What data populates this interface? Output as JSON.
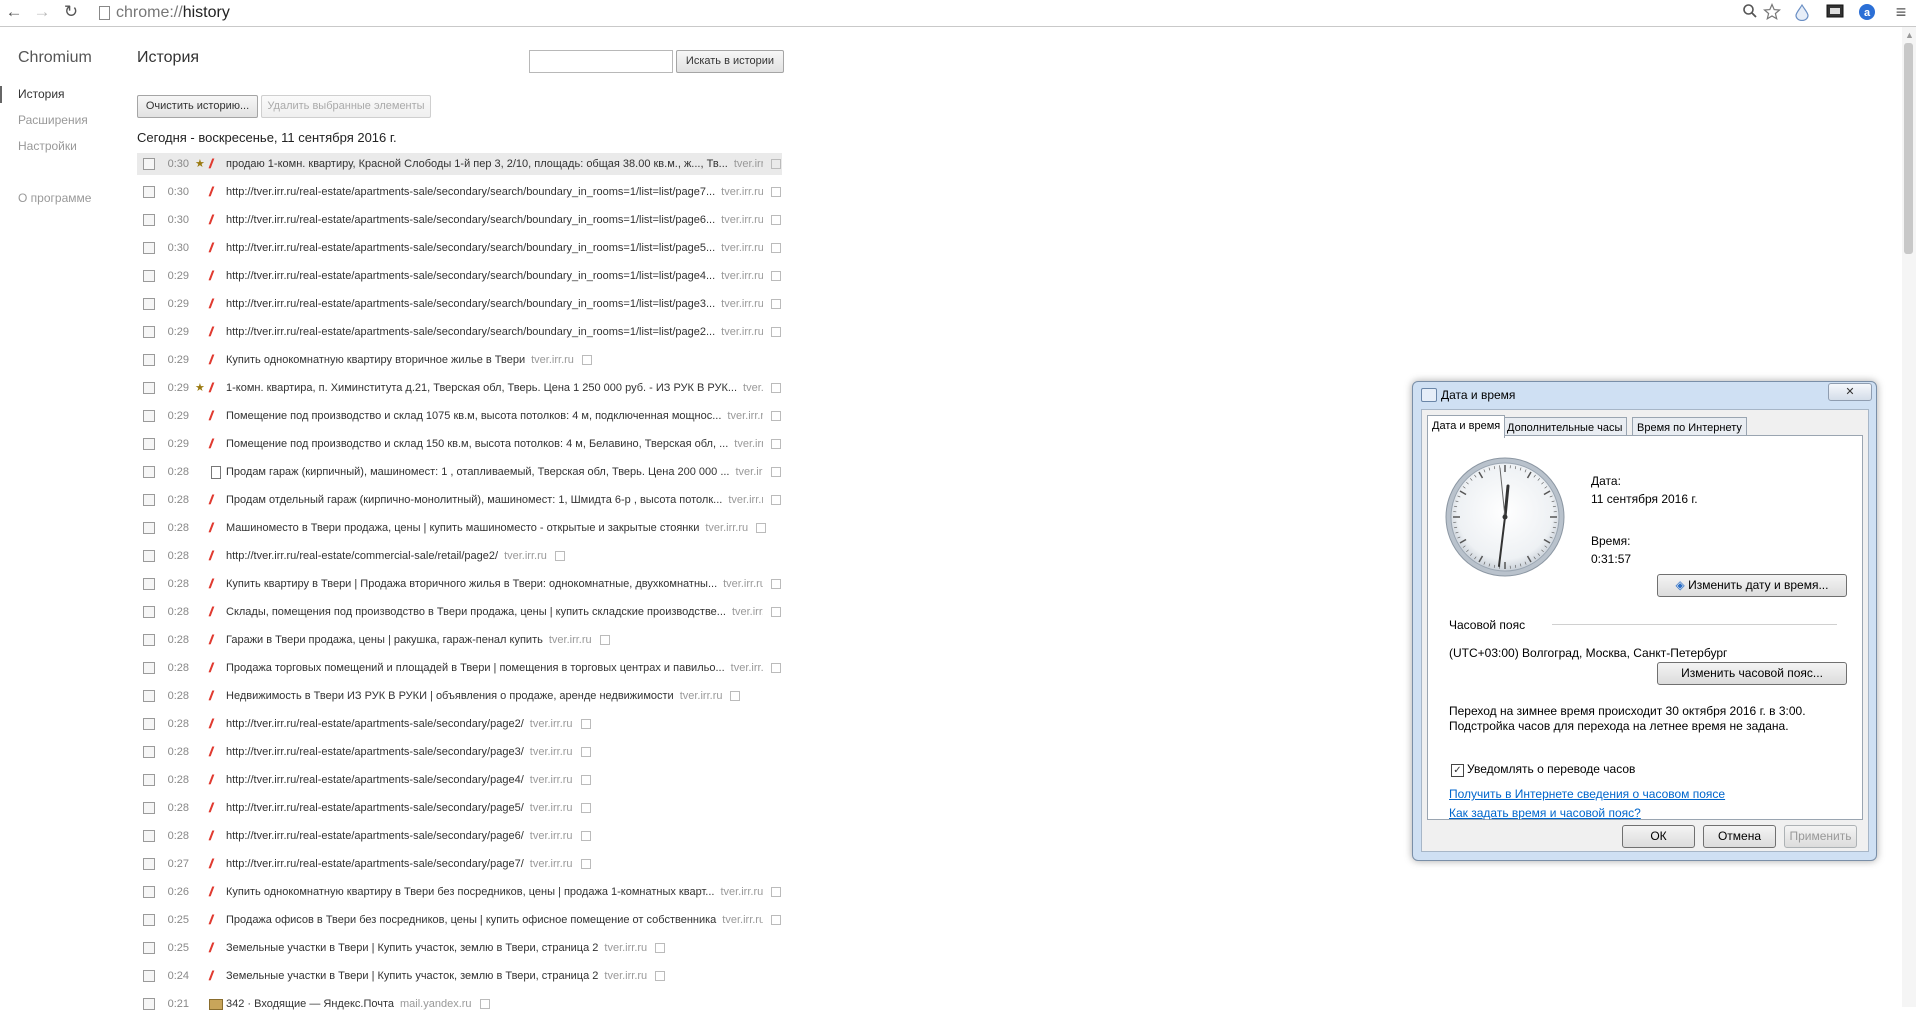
{
  "browser": {
    "url_scheme": "chrome://",
    "url_path": "history",
    "back_glyph": "←",
    "forward_glyph": "→",
    "reload_glyph": "↻",
    "menu_glyph": "≡"
  },
  "sidebar": {
    "brand": "Chromium",
    "items": [
      {
        "label": "История"
      },
      {
        "label": "Расширения"
      },
      {
        "label": "Настройки"
      },
      {
        "label": "О программе"
      }
    ]
  },
  "main": {
    "title": "История",
    "search_button": "Искать в истории",
    "clear_button": "Очистить историю...",
    "remove_button": "Удалить выбранные элементы",
    "day_header": "Сегодня - воскресенье, 11 сентября 2016 г."
  },
  "entries": [
    {
      "time": "0:30",
      "title": "продаю 1-комн. квартиру, Красной Слободы 1-й пер 3, 2/10, площадь: общая 38.00 кв.м., ж..., Тв...",
      "domain": "tver.irr.ru",
      "icon": "irr-icon",
      "starred": true
    },
    {
      "time": "0:30",
      "title": "http://tver.irr.ru/real-estate/apartments-sale/secondary/search/boundary_in_rooms=1/list=list/page7...",
      "domain": "tver.irr.ru",
      "icon": "irr-icon",
      "starred": false
    },
    {
      "time": "0:30",
      "title": "http://tver.irr.ru/real-estate/apartments-sale/secondary/search/boundary_in_rooms=1/list=list/page6...",
      "domain": "tver.irr.ru",
      "icon": "irr-icon",
      "starred": false
    },
    {
      "time": "0:30",
      "title": "http://tver.irr.ru/real-estate/apartments-sale/secondary/search/boundary_in_rooms=1/list=list/page5...",
      "domain": "tver.irr.ru",
      "icon": "irr-icon",
      "starred": false
    },
    {
      "time": "0:29",
      "title": "http://tver.irr.ru/real-estate/apartments-sale/secondary/search/boundary_in_rooms=1/list=list/page4...",
      "domain": "tver.irr.ru",
      "icon": "irr-icon",
      "starred": false
    },
    {
      "time": "0:29",
      "title": "http://tver.irr.ru/real-estate/apartments-sale/secondary/search/boundary_in_rooms=1/list=list/page3...",
      "domain": "tver.irr.ru",
      "icon": "irr-icon",
      "starred": false
    },
    {
      "time": "0:29",
      "title": "http://tver.irr.ru/real-estate/apartments-sale/secondary/search/boundary_in_rooms=1/list=list/page2...",
      "domain": "tver.irr.ru",
      "icon": "irr-icon",
      "starred": false
    },
    {
      "time": "0:29",
      "title": "Купить однокомнатную квартиру вторичное жилье в Твери",
      "domain": "tver.irr.ru",
      "icon": "irr-icon",
      "starred": false
    },
    {
      "time": "0:29",
      "title": "1-комн. квартира, п. Химинститута д.21, Тверская обл, Тверь. Цена 1 250 000 руб. - ИЗ РУК В РУК...",
      "domain": "tver.irr.ru",
      "icon": "irr-icon",
      "starred": true
    },
    {
      "time": "0:29",
      "title": "Помещение под производство и склад 1075 кв.м, высота потолков: 4 м, подключенная мощнос...",
      "domain": "tver.irr.ru",
      "icon": "irr-icon",
      "starred": false
    },
    {
      "time": "0:29",
      "title": "Помещение под производство и склад 150 кв.м, высота потолков: 4 м, Белавино, Тверская обл, ...",
      "domain": "tver.irr.ru",
      "icon": "irr-icon",
      "starred": false
    },
    {
      "time": "0:28",
      "title": "Продам гараж (кирпичный), машиномест: 1 , отапливаемый, Тверская обл, Тверь. Цена 200 000 ...",
      "domain": "tver.irr.ru",
      "icon": "page-icon",
      "starred": false
    },
    {
      "time": "0:28",
      "title": "Продам отдельный гараж (кирпично-монолитный), машиномест: 1, Шмидта 6-р , высота потолк...",
      "domain": "tver.irr.ru",
      "icon": "irr-icon",
      "starred": false
    },
    {
      "time": "0:28",
      "title": "Машиноместо в Твери продажа, цены | купить машиноместо - открытые и закрытые стоянки",
      "domain": "tver.irr.ru",
      "icon": "irr-icon",
      "starred": false
    },
    {
      "time": "0:28",
      "title": "http://tver.irr.ru/real-estate/commercial-sale/retail/page2/",
      "domain": "tver.irr.ru",
      "icon": "irr-icon",
      "starred": false
    },
    {
      "time": "0:28",
      "title": "Купить квартиру в Твери | Продажа вторичного жилья в Твери: однокомнатные, двухкомнатны...",
      "domain": "tver.irr.ru",
      "icon": "irr-icon",
      "starred": false
    },
    {
      "time": "0:28",
      "title": "Склады, помещения под производство в Твери продажа, цены | купить складские производстве...",
      "domain": "tver.irr.ru",
      "icon": "irr-icon",
      "starred": false
    },
    {
      "time": "0:28",
      "title": "Гаражи в Твери продажа, цены | ракушка, гараж-пенал купить",
      "domain": "tver.irr.ru",
      "icon": "irr-icon",
      "starred": false
    },
    {
      "time": "0:28",
      "title": "Продажа торговых помещений и площадей в Твери | помещения в торговых центрах и павильо...",
      "domain": "tver.irr.ru",
      "icon": "irr-icon",
      "starred": false
    },
    {
      "time": "0:28",
      "title": "Недвижимость в Твери ИЗ РУК В РУКИ | объявления о продаже, аренде недвижимости",
      "domain": "tver.irr.ru",
      "icon": "irr-icon",
      "starred": false
    },
    {
      "time": "0:28",
      "title": "http://tver.irr.ru/real-estate/apartments-sale/secondary/page2/",
      "domain": "tver.irr.ru",
      "icon": "irr-icon",
      "starred": false
    },
    {
      "time": "0:28",
      "title": "http://tver.irr.ru/real-estate/apartments-sale/secondary/page3/",
      "domain": "tver.irr.ru",
      "icon": "irr-icon",
      "starred": false
    },
    {
      "time": "0:28",
      "title": "http://tver.irr.ru/real-estate/apartments-sale/secondary/page4/",
      "domain": "tver.irr.ru",
      "icon": "irr-icon",
      "starred": false
    },
    {
      "time": "0:28",
      "title": "http://tver.irr.ru/real-estate/apartments-sale/secondary/page5/",
      "domain": "tver.irr.ru",
      "icon": "irr-icon",
      "starred": false
    },
    {
      "time": "0:28",
      "title": "http://tver.irr.ru/real-estate/apartments-sale/secondary/page6/",
      "domain": "tver.irr.ru",
      "icon": "irr-icon",
      "starred": false
    },
    {
      "time": "0:27",
      "title": "http://tver.irr.ru/real-estate/apartments-sale/secondary/page7/",
      "domain": "tver.irr.ru",
      "icon": "irr-icon",
      "starred": false
    },
    {
      "time": "0:26",
      "title": "Купить однокомнатную квартиру в Твери без посредников, цены | продажа 1-комнатных кварт...",
      "domain": "tver.irr.ru",
      "icon": "irr-icon",
      "starred": false
    },
    {
      "time": "0:25",
      "title": "Продажа офисов в Твери без посредников, цены | купить офисное помещение от собственника",
      "domain": "tver.irr.ru",
      "icon": "irr-icon",
      "starred": false
    },
    {
      "time": "0:25",
      "title": "Земельные участки в Твери | Купить участок, землю в Твери, страница 2",
      "domain": "tver.irr.ru",
      "icon": "irr-icon",
      "starred": false
    },
    {
      "time": "0:24",
      "title": "Земельные участки в Твери | Купить участок, землю в Твери, страница 2",
      "domain": "tver.irr.ru",
      "icon": "irr-icon",
      "starred": false
    },
    {
      "time": "0:21",
      "title": "342 · Входящие — Яндекс.Почта",
      "domain": "mail.yandex.ru",
      "icon": "mail-icon",
      "starred": false
    }
  ],
  "dialog": {
    "title": "Дата и время",
    "close_glyph": "✕",
    "tabs": [
      {
        "label": "Дата и время"
      },
      {
        "label": "Дополнительные часы"
      },
      {
        "label": "Время по Интернету"
      }
    ],
    "date_label": "Дата:",
    "date_value": "11 сентября 2016 г.",
    "time_label": "Время:",
    "time_value": "0:31:57",
    "change_datetime_button": "Изменить дату и время...",
    "timezone_label": "Часовой пояс",
    "timezone_value": "(UTC+03:00) Волгоград, Москва, Санкт-Петербург",
    "change_timezone_button": "Изменить часовой пояс...",
    "dst_line1": "Переход на зимнее время происходит 30 октября 2016 г. в 3:00.",
    "dst_line2": "Подстройка часов для перехода на летнее время не задана.",
    "notify_label": "Уведомлять о переводе часов",
    "notify_checked": true,
    "link1": "Получить в Интернете сведения о часовом поясе",
    "link2": "Как задать время и часовой пояс?",
    "ok_button": "ОК",
    "cancel_button": "Отмена",
    "apply_button": "Применить"
  }
}
